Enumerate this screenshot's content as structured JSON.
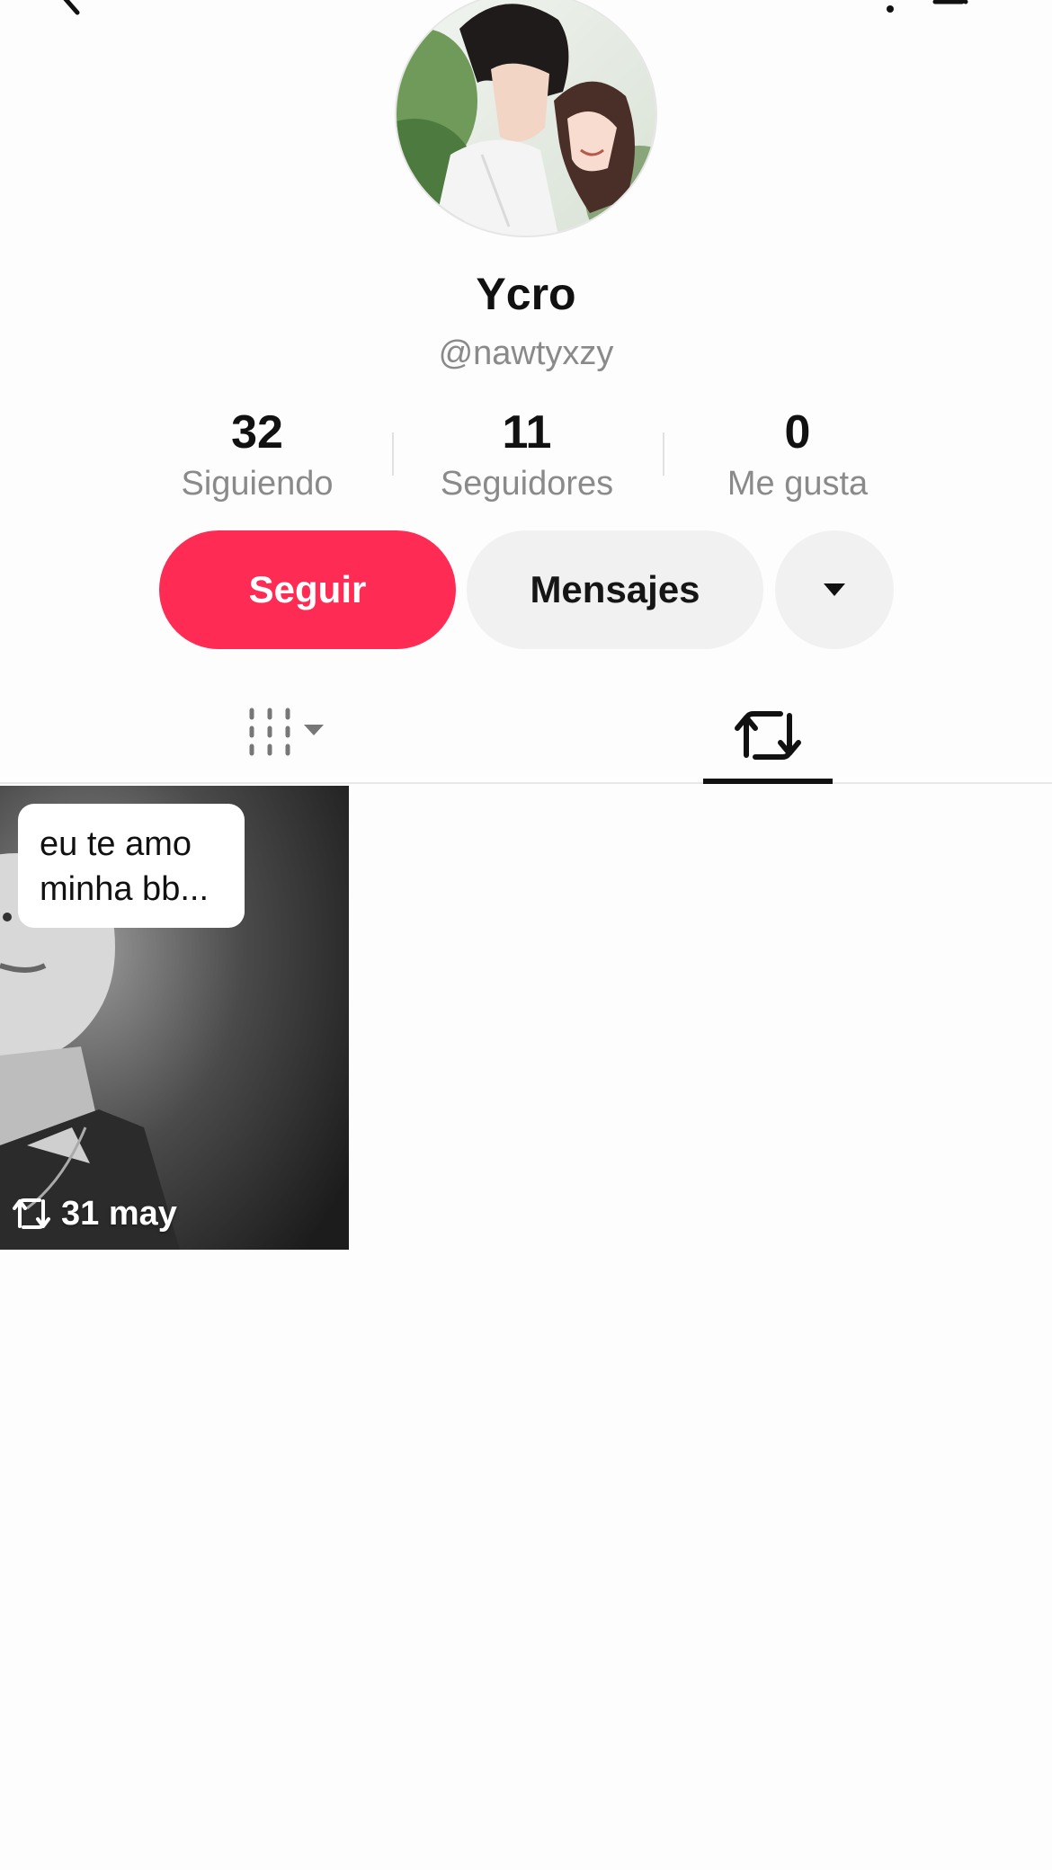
{
  "profile": {
    "display_name": "Ycro",
    "username": "@nawtyxzy",
    "avatar_icon": "profile-photo"
  },
  "stats": [
    {
      "value": "32",
      "label": "Siguiendo"
    },
    {
      "value": "11",
      "label": "Seguidores"
    },
    {
      "value": "0",
      "label": "Me gusta"
    }
  ],
  "actions": {
    "follow_label": "Seguir",
    "message_label": "Mensajes",
    "more_icon": "caret-down-icon"
  },
  "tabs": {
    "videos_icon": "grid-icon",
    "reposts_icon": "repost-icon",
    "active": "reposts"
  },
  "reposts": [
    {
      "caption": "eu te amo minha bb...",
      "caption_line1": "eu te amo",
      "caption_line2": "minha bb...",
      "date": "31 may",
      "icon": "repost-icon"
    }
  ],
  "colors": {
    "accent": "#fe2c55",
    "secondary_button": "#f1f1f1",
    "muted_text": "#8a8a8a"
  }
}
